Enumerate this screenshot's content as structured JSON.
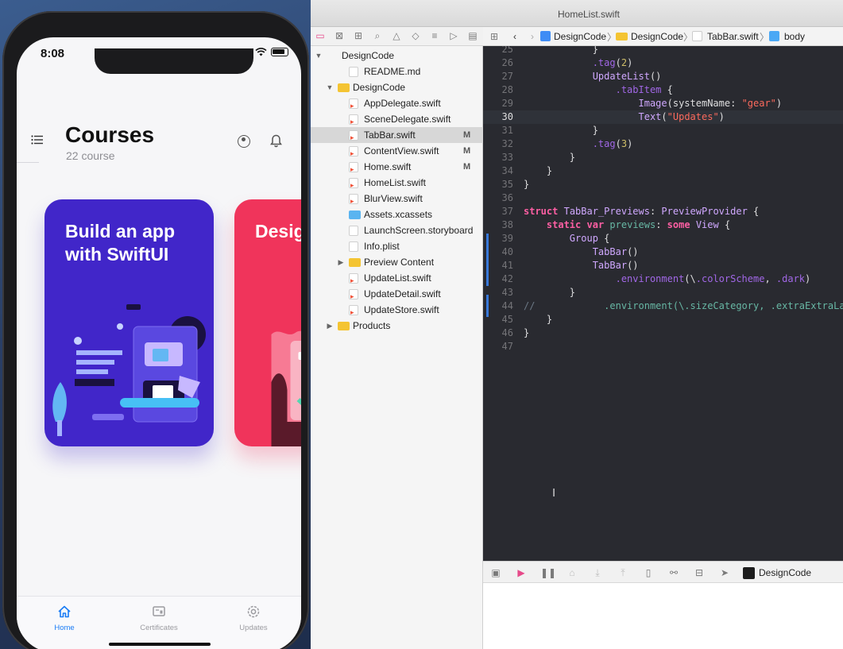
{
  "simulator": {
    "status_time": "8:08",
    "page_title": "Courses",
    "page_subtitle": "22 course",
    "cards": [
      {
        "title": "Build an app with SwiftUI",
        "color": "#4126c9"
      },
      {
        "title": "Design Course",
        "color": "#f0345b"
      }
    ],
    "tabs": [
      {
        "label": "Home",
        "icon": "house-icon",
        "active": true
      },
      {
        "label": "Certificates",
        "icon": "certificate-icon",
        "active": false
      },
      {
        "label": "Updates",
        "icon": "gear-icon",
        "active": false
      }
    ],
    "accent": "#1a7cf5"
  },
  "xcode": {
    "window_title": "HomeList.swift",
    "navigator": {
      "items": [
        {
          "label": "DesignCode",
          "type": "project",
          "disclosure": "▼",
          "indent": 0
        },
        {
          "label": "README.md",
          "type": "doc",
          "indent": 2
        },
        {
          "label": "DesignCode",
          "type": "folder",
          "disclosure": "▼",
          "indent": 1
        },
        {
          "label": "AppDelegate.swift",
          "type": "swift",
          "indent": 2
        },
        {
          "label": "SceneDelegate.swift",
          "type": "swift",
          "indent": 2
        },
        {
          "label": "TabBar.swift",
          "type": "swift",
          "indent": 2,
          "badge": "M",
          "selected": true
        },
        {
          "label": "ContentView.swift",
          "type": "swift",
          "indent": 2,
          "badge": "M"
        },
        {
          "label": "Home.swift",
          "type": "swift",
          "indent": 2,
          "badge": "M"
        },
        {
          "label": "HomeList.swift",
          "type": "swift",
          "indent": 2
        },
        {
          "label": "BlurView.swift",
          "type": "swift",
          "indent": 2
        },
        {
          "label": "Assets.xcassets",
          "type": "assets",
          "indent": 2
        },
        {
          "label": "LaunchScreen.storyboard",
          "type": "board",
          "indent": 2
        },
        {
          "label": "Info.plist",
          "type": "plist",
          "indent": 2
        },
        {
          "label": "Preview Content",
          "type": "folder",
          "disclosure": "▶",
          "indent": 2
        },
        {
          "label": "UpdateList.swift",
          "type": "swift",
          "indent": 2
        },
        {
          "label": "UpdateDetail.swift",
          "type": "swift",
          "indent": 2
        },
        {
          "label": "UpdateStore.swift",
          "type": "swift",
          "indent": 2
        },
        {
          "label": "Products",
          "type": "folder",
          "disclosure": "▶",
          "indent": 1
        }
      ]
    },
    "jumpbar": {
      "project": "DesignCode",
      "group": "DesignCode",
      "file": "TabBar.swift",
      "symbol": "body"
    },
    "editor": {
      "current_line": "30",
      "lines": [
        {
          "n": "25",
          "code": "            }"
        },
        {
          "n": "26",
          "code": "            .tag(2)"
        },
        {
          "n": "27",
          "code": "            UpdateList()"
        },
        {
          "n": "28",
          "code": "                .tabItem {"
        },
        {
          "n": "29",
          "code": "                    Image(systemName: \"gear\")"
        },
        {
          "n": "30",
          "code": "                    Text(\"Updates\")"
        },
        {
          "n": "31",
          "code": "            }"
        },
        {
          "n": "32",
          "code": "            .tag(3)"
        },
        {
          "n": "33",
          "code": "        }"
        },
        {
          "n": "34",
          "code": "    }"
        },
        {
          "n": "35",
          "code": "}"
        },
        {
          "n": "36",
          "code": ""
        },
        {
          "n": "37",
          "code": "struct TabBar_Previews: PreviewProvider {"
        },
        {
          "n": "38",
          "code": "    static var previews: some View {"
        },
        {
          "n": "39",
          "code": "        Group {"
        },
        {
          "n": "40",
          "code": "            TabBar()"
        },
        {
          "n": "41",
          "code": "            TabBar()"
        },
        {
          "n": "42",
          "code": "                .environment(\\.colorScheme, .dark)"
        },
        {
          "n": "43",
          "code": "        }"
        },
        {
          "n": "44",
          "code": "//            .environment(\\.sizeCategory, .extraExtraLarge)"
        },
        {
          "n": "45",
          "code": "    }"
        },
        {
          "n": "46",
          "code": "}"
        },
        {
          "n": "47",
          "code": ""
        }
      ]
    },
    "debug_target": "DesignCode"
  }
}
